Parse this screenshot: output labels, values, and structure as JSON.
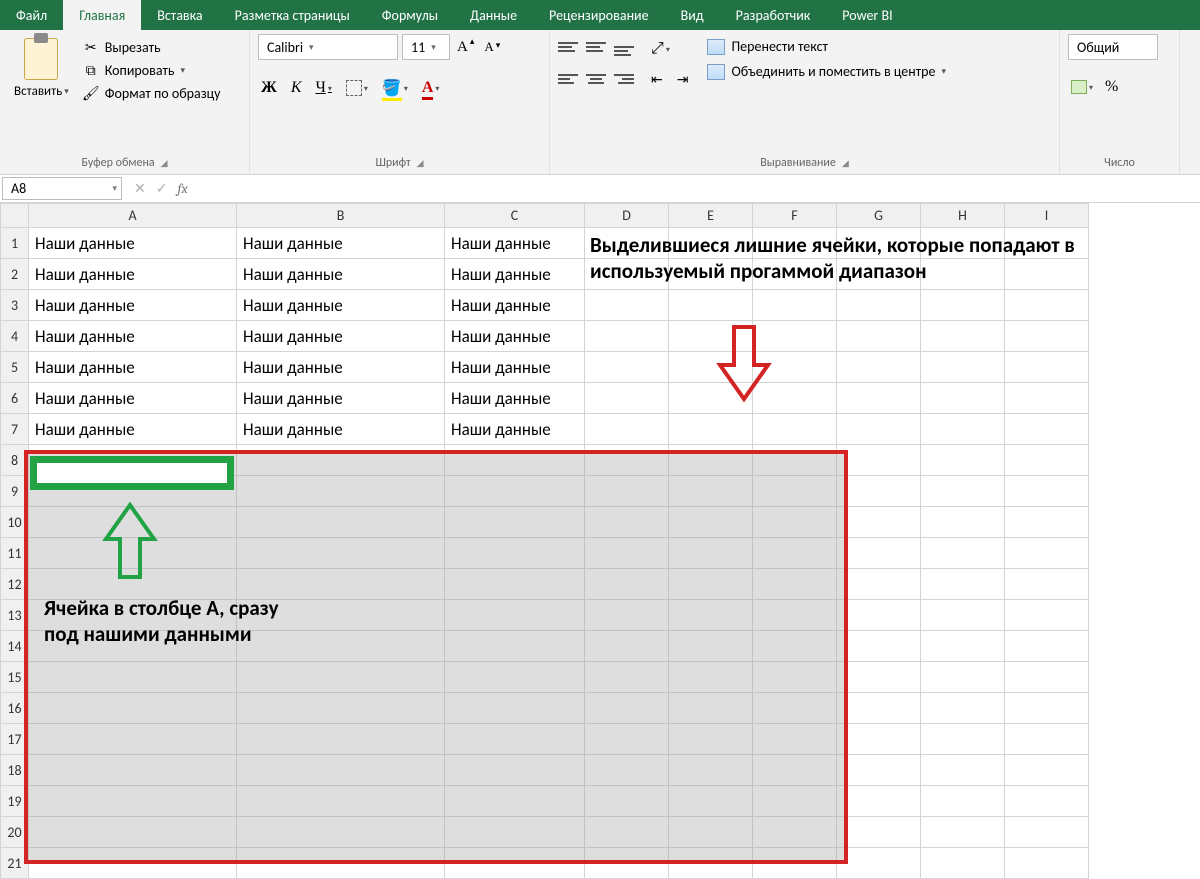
{
  "tabs": [
    "Файл",
    "Главная",
    "Вставка",
    "Разметка страницы",
    "Формулы",
    "Данные",
    "Рецензирование",
    "Вид",
    "Разработчик",
    "Power BI"
  ],
  "active_tab_index": 1,
  "clipboard": {
    "paste": "Вставить",
    "cut": "Вырезать",
    "copy": "Копировать",
    "format_painter": "Формат по образцу",
    "group": "Буфер обмена"
  },
  "font": {
    "name": "Calibri",
    "size": "11",
    "bold": "Ж",
    "italic": "К",
    "underline": "Ч",
    "group": "Шрифт"
  },
  "alignment": {
    "wrap": "Перенести текст",
    "merge": "Объединить и поместить в центре",
    "group": "Выравнивание"
  },
  "number": {
    "format": "Общий",
    "percent": "%",
    "group": "Число"
  },
  "name_box": "A8",
  "fx": "fx",
  "columns": [
    "A",
    "B",
    "C",
    "D",
    "E",
    "F",
    "G",
    "H",
    "I"
  ],
  "row_count": 21,
  "cell_text": "Наши данные",
  "annotation_top": "Выделившиеся лишние ячейки, которые попадают в используемый прогаммой диапазон",
  "annotation_bottom": "Ячейка в столбце A, сразу под нашими данными"
}
